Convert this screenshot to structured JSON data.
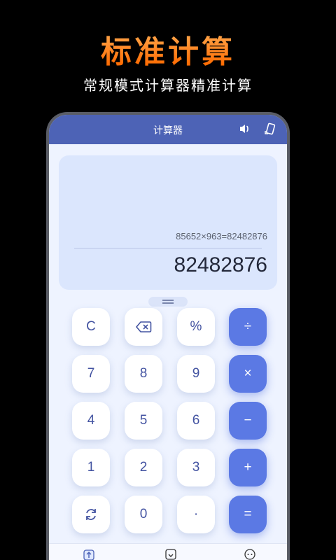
{
  "promo": {
    "title": "标准计算",
    "subtitle": "常规模式计算器精准计算"
  },
  "app": {
    "title": "计算器",
    "icons": [
      "speaker-icon",
      "rotate-icon"
    ]
  },
  "display": {
    "expression": "85652×963=82482876",
    "result": "82482876"
  },
  "keypad": {
    "rows": [
      [
        {
          "label": "C"
        },
        {
          "label": "",
          "icon": "backspace-icon"
        },
        {
          "label": "%"
        },
        {
          "label": "÷",
          "op": true
        }
      ],
      [
        {
          "label": "7"
        },
        {
          "label": "8"
        },
        {
          "label": "9"
        },
        {
          "label": "×",
          "op": true
        }
      ],
      [
        {
          "label": "4"
        },
        {
          "label": "5"
        },
        {
          "label": "6"
        },
        {
          "label": "−",
          "op": true
        }
      ],
      [
        {
          "label": "1"
        },
        {
          "label": "2"
        },
        {
          "label": "3"
        },
        {
          "label": "+",
          "op": true
        }
      ],
      [
        {
          "label": "",
          "icon": "refresh-icon"
        },
        {
          "label": "0"
        },
        {
          "label": "·"
        },
        {
          "label": "=",
          "op": true
        }
      ]
    ]
  },
  "bottom_nav": {
    "icons": [
      "upload-icon",
      "download-icon",
      "chat-icon"
    ]
  },
  "colors": {
    "accent": "#5b79e4",
    "app_bar": "#4d63b6",
    "promo_gradient": [
      "#ffb25a",
      "#ff6a00"
    ]
  }
}
